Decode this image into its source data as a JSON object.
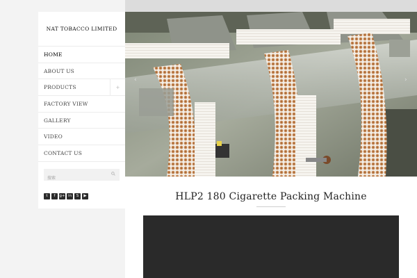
{
  "logo": {
    "text": "NAT TOBACCO LIMITED"
  },
  "nav": {
    "items": [
      {
        "label": "HOME"
      },
      {
        "label": "ABOUT US"
      },
      {
        "label": "PRODUCTS",
        "expand_symbol": "+"
      },
      {
        "label": "FACTORY VIEW"
      },
      {
        "label": "GALLERY"
      },
      {
        "label": "VIDEO"
      },
      {
        "label": "CONTACT US"
      }
    ],
    "active": "HOME"
  },
  "search": {
    "placeholder": "搜索"
  },
  "social": {
    "icons": [
      {
        "name": "twitter-icon",
        "glyph": "t"
      },
      {
        "name": "facebook-icon",
        "glyph": "f"
      },
      {
        "name": "google-plus-icon",
        "glyph": "g+"
      },
      {
        "name": "linkedin-icon",
        "glyph": "in"
      },
      {
        "name": "skype-icon",
        "glyph": "S"
      },
      {
        "name": "youtube-icon",
        "glyph": "▶"
      }
    ]
  },
  "slider": {
    "prev_symbol": "‹",
    "next_symbol": "›"
  },
  "product": {
    "title": "HLP2 180 Cigarette Packing Machine"
  },
  "colors": {
    "sidebar_bg": "#ffffff",
    "page_bg": "#f3f3f3",
    "video_bg": "#2a2a2a",
    "social_bg": "#2b2b2b"
  }
}
